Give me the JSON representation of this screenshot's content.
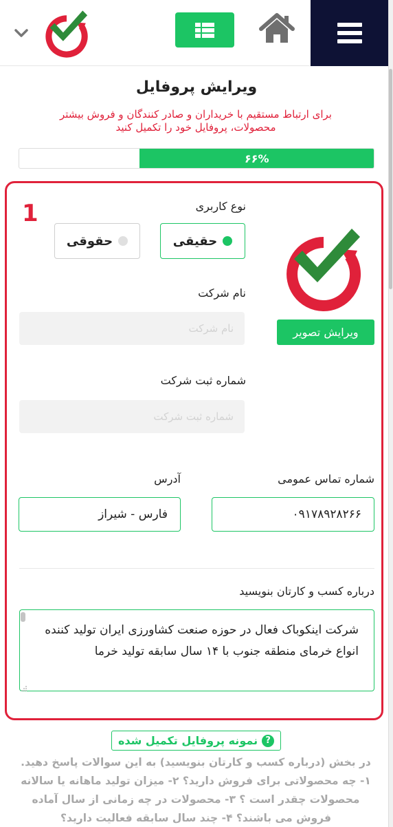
{
  "header": {
    "menu_icon": "hamburger-icon",
    "home_icon": "home-icon",
    "grid_icon": "grid-list-icon",
    "logo_icon": "brand-logo-icon",
    "dropdown_icon": "chevron-down-icon"
  },
  "profile": {
    "title": "ویرایش پروفایل",
    "subtitle": "برای ارتباط مستقیم با خریداران و صادر کنندگان و فروش بیشتر محصولات، پروفایل خود را تکمیل کنید",
    "progress_label": "۶۶%",
    "progress_value": 0.66
  },
  "form": {
    "step_number": "1",
    "user_type_label": "نوع کاربری",
    "user_type_options": [
      "حقیقی",
      "حقوقی"
    ],
    "user_type_selected": "حقیقی",
    "edit_image_label": "ویرایش تصویر",
    "company_name_label": "نام شرکت",
    "company_name_placeholder": "نام شرکت",
    "registration_label": "شماره ثبت شرکت",
    "registration_placeholder": "شماره ثبت شرکت",
    "phone_label": "شماره تماس عمومی",
    "phone_value": "۰۹۱۷۸۹۲۸۲۶۶",
    "address_label": "آدرس",
    "address_value": "فارس - شیراز",
    "about_label": "درباره کسب و کارتان بنویسید",
    "about_value": "شرکت اینکوباک فعال در حوزه صنعت کشاورزی ایران تولید کننده انواع خرمای منطقه جنوب با ۱۴ سال سابقه تولید خرما"
  },
  "help": {
    "sample_label": "نمونه پروفایل تکمیل شده",
    "sample_icon": "question-circle-icon",
    "hint_text": "در بخش (درباره کسب و کارتان بنویسید) به این سوالات پاسخ دهید. ۱- چه محصولاتی برای فروش دارید؟ ۲- میزان تولید ماهانه یا سالانه محصولات چقدر است ؟ ۳- محصولات در چه زمانی از سال آماده فروش می باشند؟ ۴- چند سال سابقه فعالیت دارید؟"
  },
  "colors": {
    "accent_green": "#1cc564",
    "brand_red": "#e0213a",
    "nav_dark": "#0e1235"
  }
}
